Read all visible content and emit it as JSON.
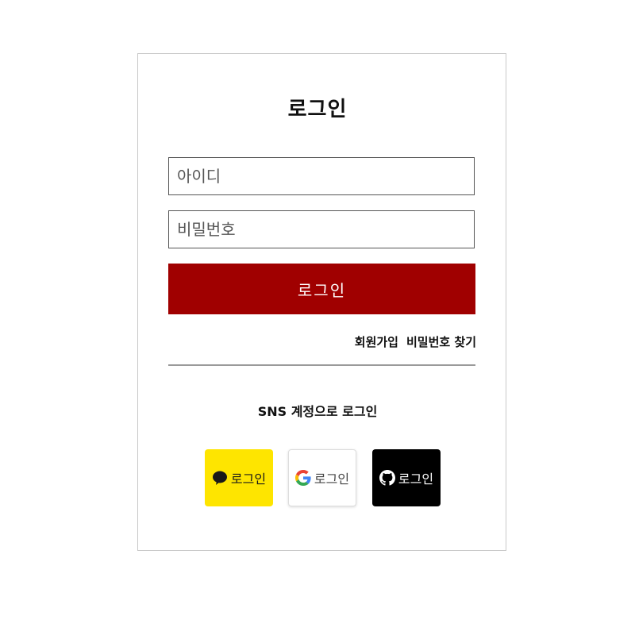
{
  "login": {
    "title": "로그인",
    "id_placeholder": "아이디",
    "pw_placeholder": "비밀번호",
    "submit_label": "로그인",
    "signup_link": "회원가입",
    "find_pw_link": "비밀번호 찾기"
  },
  "sns": {
    "title": "SNS 계정으로 로그인",
    "kakao_label": "로그인",
    "google_label": "로그인",
    "github_label": "로그인",
    "kakao_icon": "kakao-speech-bubble-icon",
    "google_icon": "google-g-icon",
    "github_icon": "github-octocat-icon"
  },
  "colors": {
    "primary": "#a00000",
    "kakao": "#fee500",
    "github": "#000000"
  }
}
